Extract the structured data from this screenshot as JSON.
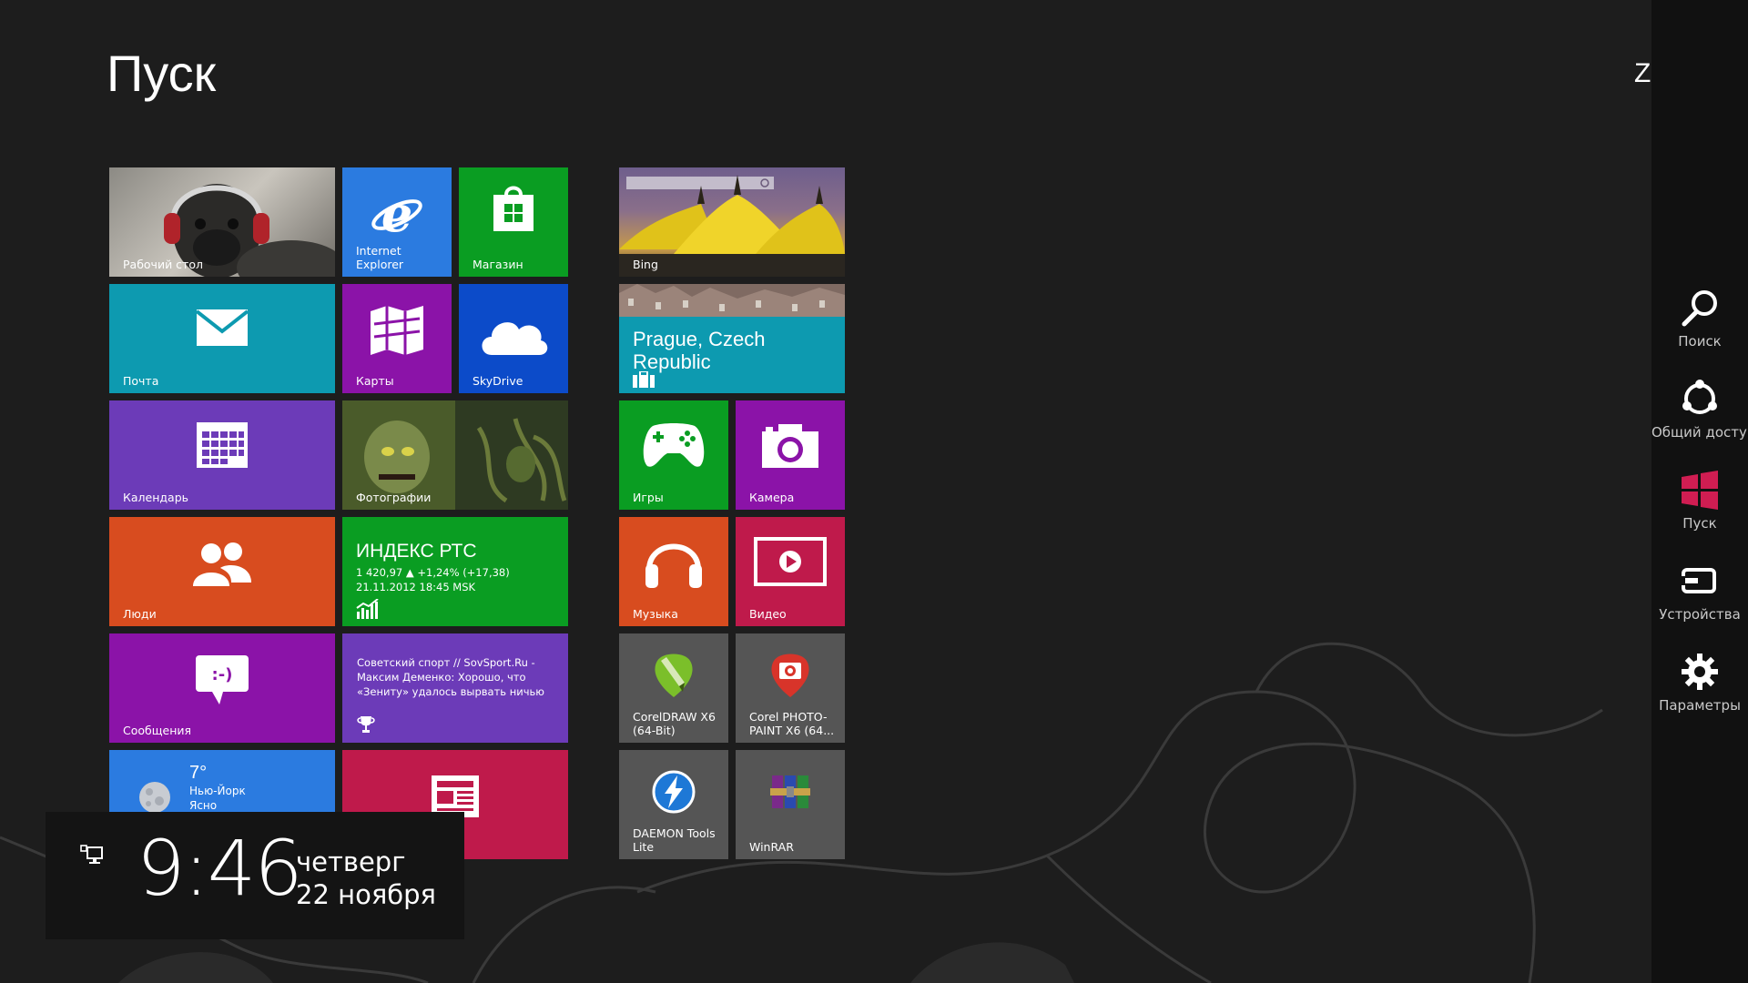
{
  "start": {
    "title": "Пуск",
    "user_fragment": "Z"
  },
  "tiles": {
    "desktop": {
      "label": "Рабочий стол"
    },
    "ie": {
      "label": "Internet Explorer"
    },
    "store": {
      "label": "Магазин"
    },
    "mail": {
      "label": "Почта"
    },
    "maps": {
      "label": "Карты"
    },
    "skydrive": {
      "label": "SkyDrive"
    },
    "calendar": {
      "label": "Календарь"
    },
    "photos": {
      "label": "Фотографии"
    },
    "people": {
      "label": "Люди"
    },
    "finance": {
      "title": "ИНДЕКС РТС",
      "line1": "1 420,97 ▲ +1,24% (+17,38)",
      "line2": "21.11.2012 18:45 MSK"
    },
    "messages": {
      "label": "Сообщения"
    },
    "sport": {
      "headline": "Советский спорт // SovSport.Ru - Максим Деменко: Хорошо, что «Зениту» удалось вырвать ничью"
    },
    "weather": {
      "temp": "7°",
      "city": "Нью-Йорк",
      "condition": "Ясно"
    },
    "news": {},
    "bing": {
      "label": "Bing"
    },
    "travel": {
      "title": "Prague, Czech Republic"
    },
    "games": {
      "label": "Игры"
    },
    "camera": {
      "label": "Камера"
    },
    "music": {
      "label": "Музыка"
    },
    "video": {
      "label": "Видео"
    },
    "coreldraw": {
      "label": "CorelDRAW X6 (64-Bit)"
    },
    "photopaint": {
      "label": "Corel PHOTO-PAINT X6 (64..."
    },
    "daemon": {
      "label": "DAEMON Tools Lite"
    },
    "winrar": {
      "label": "WinRAR"
    }
  },
  "charms": {
    "search": "Поиск",
    "share": "Общий доступ",
    "start": "Пуск",
    "devices": "Устройства",
    "settings": "Параметры"
  },
  "clock": {
    "time": "9:46",
    "day": "четверг",
    "date": "22 ноября"
  },
  "colors": {
    "background": "#1d1d1d",
    "charms_bar": "#111111",
    "teal": "#0d9ab0",
    "purple": "#8b13a8",
    "green": "#0a9d22",
    "blue": "#2671d9",
    "orange": "#d84c1f",
    "crimson": "#bf1a4b",
    "violet": "#6c3bb8",
    "gray": "#555555",
    "windows_red": "#d01d52"
  }
}
